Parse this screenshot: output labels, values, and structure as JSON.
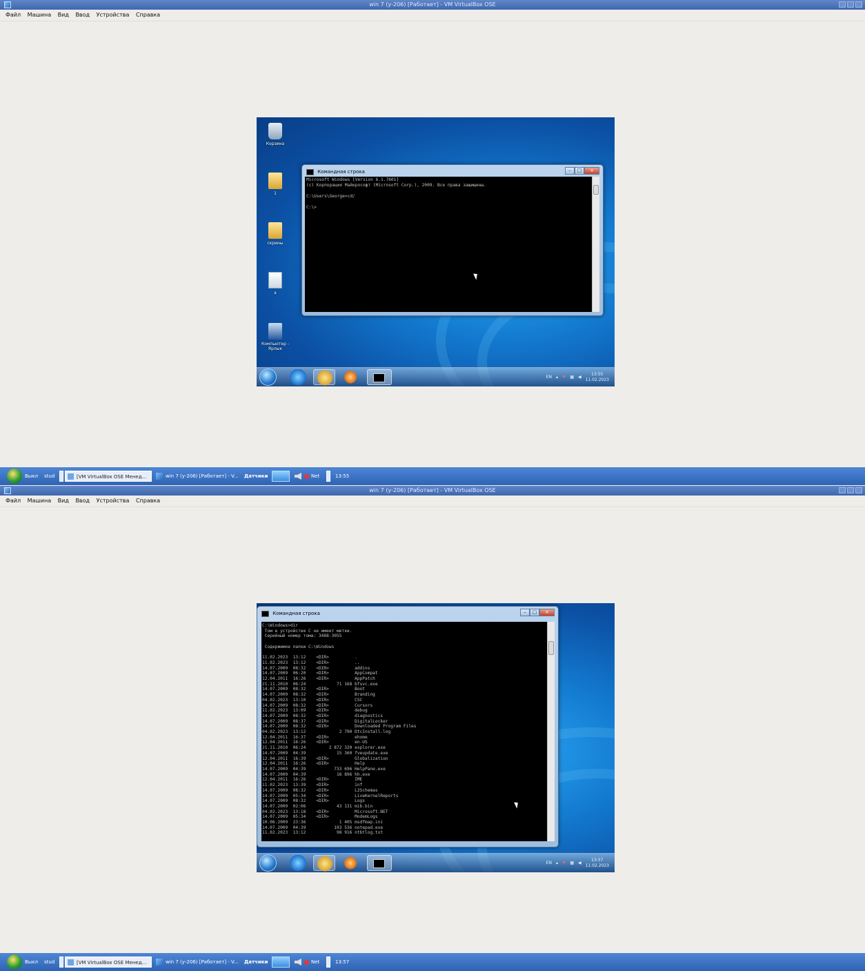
{
  "screens": [
    {
      "window_title": "win 7 (у-206) [Работает] - VM VirtualBox OSE",
      "menu": [
        "Файл",
        "Машина",
        "Вид",
        "Ввод",
        "Устройства",
        "Справка"
      ],
      "desktop_icons": [
        {
          "label": "Корзина",
          "icon": "recycle-bin-icon"
        },
        {
          "label": "1",
          "icon": "folder-icon"
        },
        {
          "label": "скрины",
          "icon": "folder-icon"
        },
        {
          "label": "а",
          "icon": "document-icon"
        },
        {
          "label": "Компьютер - Ярлык",
          "icon": "computer-shortcut-icon"
        }
      ],
      "cmd": {
        "title": "Командная строка",
        "text": "Microsoft Windows [Version 6.1.7601]\n(c) Корпорация Майкрософт (Microsoft Corp.), 2009. Все права защищены.\n\nC:\\Users\\George>cd/\n\nC:\\>"
      },
      "guest_tray": {
        "lang": "EN",
        "time": "13:55",
        "date": "11.02.2023"
      },
      "host_taskbar": {
        "logout": "Выкл",
        "user": "stud",
        "task1": "[VM VirtualBox OSE Менед...",
        "task2": "win 7 (у-206) [Работает] - V...",
        "sensors": "Датчики",
        "net": "Net",
        "clock": "13:55"
      }
    },
    {
      "window_title": "win 7 (у-206) [Работает] - VM VirtualBox OSE",
      "menu": [
        "Файл",
        "Машина",
        "Вид",
        "Ввод",
        "Устройства",
        "Справка"
      ],
      "cmd": {
        "title": "Командная строка",
        "text": "C:\\Windows>dir\n Том в устройстве C не имеет метки.\n Серийный номер тома: 3488-3055\n\n Содержимое папки C:\\Windows\n\n11.02.2023  13:12    <DIR>          .\n11.02.2023  13:12    <DIR>          ..\n14.07.2009  08:32    <DIR>          addins\n14.07.2009  06:20    <DIR>          AppCompat\n12.04.2011  16:26    <DIR>          AppPatch\n21.11.2010  06:24            71 168 bfsvc.exe\n14.07.2009  08:32    <DIR>          Boot\n14.07.2009  08:32    <DIR>          Branding\n04.02.2023  13:10    <DIR>          CSC\n14.07.2009  08:32    <DIR>          Cursors\n11.02.2023  13:09    <DIR>          debug\n14.07.2009  08:32    <DIR>          diagnostics\n14.07.2009  08:37    <DIR>          DigitalLocker\n14.07.2009  08:32    <DIR>          Downloaded Program Files\n04.02.2023  13:12             2 790 DtcInstall.log\n12.04.2011  16:37    <DIR>          ehome\n12.04.2011  16:26    <DIR>          en-US\n21.11.2010  06:24         2 872 320 explorer.exe\n14.07.2009  04:39            15 360 fveupdate.exe\n12.04.2011  16:39    <DIR>          Globalization\n12.04.2011  16:26    <DIR>          Help\n14.07.2009  04:39           733 696 HelpPane.exe\n14.07.2009  04:39            16 896 hh.exe\n12.04.2011  16:26    <DIR>          IME\n11.02.2023  13:39    <DIR>          inf\n14.07.2009  08:32    <DIR>          L2Schemas\n14.07.2009  05:34    <DIR>          LiveKernelReports\n14.07.2009  08:32    <DIR>          Logs\n14.07.2009  02:06            43 131 mib.bin\n04.02.2023  13:18    <DIR>          Microsoft.NET\n14.07.2009  05:34    <DIR>          ModemLogs\n10.06.2009  23:36             1 405 msdfmap.ini\n14.07.2009  04:39           193 536 notepad.exe\n11.02.2023  13:12            98 916 ntbtlog.txt"
      },
      "guest_tray": {
        "lang": "EN",
        "time": "13:57",
        "date": "11.02.2023"
      },
      "host_taskbar": {
        "logout": "Выкл",
        "user": "stud",
        "task1": "[VM VirtualBox OSE Менед...",
        "task2": "win 7 (у-206) [Работает] - V...",
        "sensors": "Датчики",
        "net": "Net",
        "clock": "13:57"
      }
    }
  ]
}
